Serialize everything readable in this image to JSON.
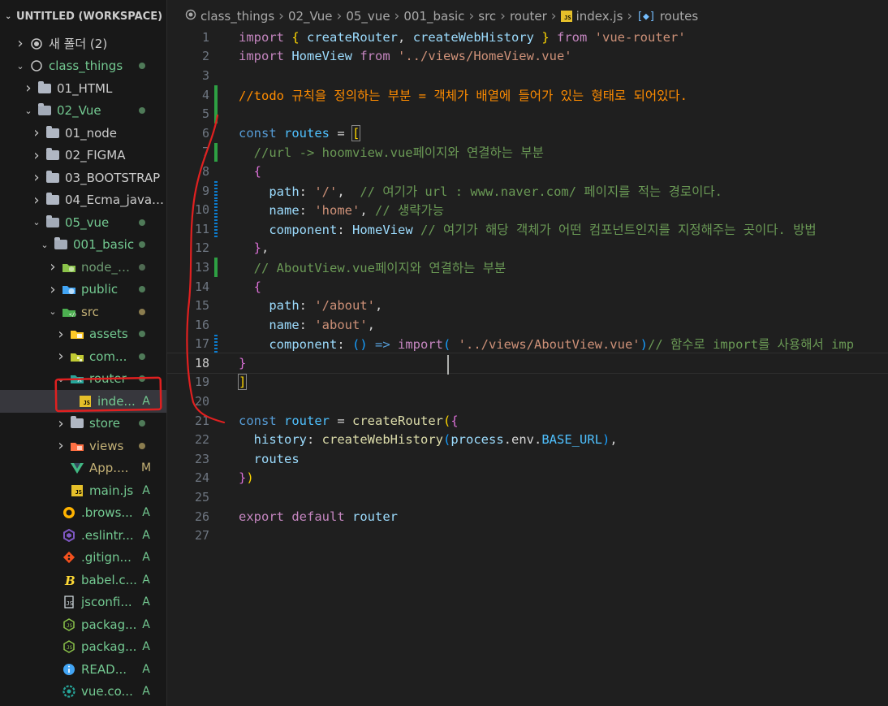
{
  "sidebar": {
    "workspace_title": "UNTITLED (WORKSPACE)",
    "items": [
      {
        "label": "새 폴더 (2)",
        "depth": 1,
        "chevron": "right",
        "icon": "circle-dot-icon",
        "status": ""
      },
      {
        "label": "class_things",
        "depth": 1,
        "chevron": "down",
        "icon": "circle-icon",
        "status": "dot-green"
      },
      {
        "label": "01_HTML",
        "depth": 2,
        "chevron": "right",
        "icon": "folder-icon",
        "status": ""
      },
      {
        "label": "02_Vue",
        "depth": 2,
        "chevron": "down",
        "icon": "folder-open-icon",
        "status": "dot-green"
      },
      {
        "label": "01_node",
        "depth": 3,
        "chevron": "right",
        "icon": "folder-icon",
        "status": ""
      },
      {
        "label": "02_FIGMA",
        "depth": 3,
        "chevron": "right",
        "icon": "folder-icon",
        "status": ""
      },
      {
        "label": "03_BOOTSTRAP",
        "depth": 3,
        "chevron": "right",
        "icon": "folder-icon",
        "status": ""
      },
      {
        "label": "04_Ecma_javas...",
        "depth": 3,
        "chevron": "right",
        "icon": "folder-icon",
        "status": ""
      },
      {
        "label": "05_vue",
        "depth": 3,
        "chevron": "down",
        "icon": "folder-open-icon",
        "status": "dot-green"
      },
      {
        "label": "001_basic",
        "depth": 4,
        "chevron": "down",
        "icon": "folder-open-icon",
        "status": "dot-green"
      },
      {
        "label": "node_modu...",
        "depth": 5,
        "chevron": "right",
        "icon": "node-folder-icon",
        "status": "dot-dim"
      },
      {
        "label": "public",
        "depth": 5,
        "chevron": "right",
        "icon": "public-folder-icon",
        "status": "dot-green"
      },
      {
        "label": "src",
        "depth": 5,
        "chevron": "down",
        "icon": "src-folder-icon",
        "status": "dot-olive"
      },
      {
        "label": "assets",
        "depth": 6,
        "chevron": "right",
        "icon": "assets-folder-icon",
        "status": "dot-green"
      },
      {
        "label": "com...",
        "depth": 6,
        "chevron": "right",
        "icon": "components-folder-icon",
        "status": "dot-green"
      },
      {
        "label": "router",
        "depth": 6,
        "chevron": "down",
        "icon": "router-folder-icon",
        "status": "dot-green"
      },
      {
        "label": "inde...",
        "depth": 7,
        "chevron": "none",
        "icon": "js-file-icon",
        "status": "A",
        "selected": true
      },
      {
        "label": "store",
        "depth": 6,
        "chevron": "right",
        "icon": "folder-icon",
        "status": "dot-green"
      },
      {
        "label": "views",
        "depth": 6,
        "chevron": "right",
        "icon": "views-folder-icon",
        "status": "dot-olive"
      },
      {
        "label": "App....",
        "depth": 6,
        "chevron": "none",
        "icon": "vue-file-icon",
        "status": "M"
      },
      {
        "label": "main.js",
        "depth": 6,
        "chevron": "none",
        "icon": "js-file-icon",
        "status": "A"
      },
      {
        "label": ".brows...",
        "depth": 5,
        "chevron": "none",
        "icon": "browserslist-icon",
        "status": "A"
      },
      {
        "label": ".eslintr...",
        "depth": 5,
        "chevron": "none",
        "icon": "eslint-icon",
        "status": "A"
      },
      {
        "label": ".gitign...",
        "depth": 5,
        "chevron": "none",
        "icon": "git-icon",
        "status": "A"
      },
      {
        "label": "babel.c...",
        "depth": 5,
        "chevron": "none",
        "icon": "babel-icon",
        "status": "A"
      },
      {
        "label": "jsconfi...",
        "depth": 5,
        "chevron": "none",
        "icon": "json-file-icon",
        "status": "A"
      },
      {
        "label": "packag...",
        "depth": 5,
        "chevron": "none",
        "icon": "npm-json-icon",
        "status": "A"
      },
      {
        "label": "packag...",
        "depth": 5,
        "chevron": "none",
        "icon": "npm-json-icon",
        "status": "A"
      },
      {
        "label": "READ...",
        "depth": 5,
        "chevron": "none",
        "icon": "info-icon",
        "status": "A"
      },
      {
        "label": "vue.co...",
        "depth": 5,
        "chevron": "none",
        "icon": "vue-config-icon",
        "status": "A"
      }
    ]
  },
  "breadcrumb": [
    "class_things",
    "02_Vue",
    "05_vue",
    "001_basic",
    "src",
    "router",
    "index.js",
    "routes"
  ],
  "editor": {
    "active_line": 18,
    "lines": [
      {
        "n": "1",
        "gutter": "",
        "tokens": [
          [
            "kw",
            "import"
          ],
          [
            "",
            "​ "
          ],
          [
            "br1",
            "{"
          ],
          [
            "",
            ""
          ],
          [
            "var",
            " createRouter"
          ],
          [
            "",
            ","
          ],
          [
            "var",
            " createWebHistory"
          ],
          [
            "",
            ""
          ],
          [
            "br1",
            " }"
          ],
          [
            "kw",
            " from"
          ],
          [
            "str",
            " 'vue-router'"
          ]
        ]
      },
      {
        "n": "2",
        "gutter": "",
        "tokens": [
          [
            "kw",
            "import"
          ],
          [
            "var",
            " HomeView"
          ],
          [
            "kw",
            " from"
          ],
          [
            "str",
            " '../views/HomeView.vue'"
          ]
        ]
      },
      {
        "n": "3",
        "gutter": "",
        "tokens": []
      },
      {
        "n": "4",
        "gutter": "add",
        "tokens": [
          [
            "todo",
            "//todo 규칙을 정의하는 부분 = 객체가 배열에 들어가 있는 형태로 되어있다."
          ]
        ]
      },
      {
        "n": "5",
        "gutter": "add",
        "tokens": []
      },
      {
        "n": "6",
        "gutter": "",
        "tokens": [
          [
            "kb",
            "const"
          ],
          [
            "const",
            " routes"
          ],
          [
            "",
            " = "
          ],
          [
            "br1 bm",
            "["
          ]
        ]
      },
      {
        "n": "7",
        "gutter": "add",
        "tokens": [
          [
            "cm",
            "  //url -> hoomview.vue페이지와 연결하는 부분"
          ]
        ]
      },
      {
        "n": "8",
        "gutter": "",
        "tokens": [
          [
            "",
            "  "
          ],
          [
            "br2",
            "{"
          ]
        ]
      },
      {
        "n": "9",
        "gutter": "mod",
        "tokens": [
          [
            "var",
            "    path"
          ],
          [
            "",
            ": "
          ],
          [
            "str",
            "'/'"
          ],
          [
            "",
            ",  "
          ],
          [
            "cm",
            "// 여기가 url : www.naver.com/ 페이지를 적는 경로이다."
          ]
        ]
      },
      {
        "n": "10",
        "gutter": "mod",
        "tokens": [
          [
            "var",
            "    name"
          ],
          [
            "",
            ": "
          ],
          [
            "str",
            "'home'"
          ],
          [
            "",
            ", "
          ],
          [
            "cm",
            "// 생략가능"
          ]
        ]
      },
      {
        "n": "11",
        "gutter": "mod",
        "tokens": [
          [
            "var",
            "    component"
          ],
          [
            "",
            ": "
          ],
          [
            "var",
            "HomeView"
          ],
          [
            "cm",
            " // 여기가 해당 객체가 어떤 컴포넌트인지를 지정해주는 곳이다. 방법"
          ]
        ]
      },
      {
        "n": "12",
        "gutter": "",
        "tokens": [
          [
            "",
            "  "
          ],
          [
            "br2",
            "}"
          ],
          [
            "",
            ","
          ]
        ]
      },
      {
        "n": "13",
        "gutter": "add",
        "tokens": [
          [
            "cm",
            "  // AboutView.vue페이지와 연결하는 부분"
          ]
        ]
      },
      {
        "n": "14",
        "gutter": "",
        "tokens": [
          [
            "",
            "  "
          ],
          [
            "br2",
            "{"
          ]
        ]
      },
      {
        "n": "15",
        "gutter": "",
        "tokens": [
          [
            "var",
            "    path"
          ],
          [
            "",
            ": "
          ],
          [
            "str",
            "'/about'"
          ],
          [
            "",
            ","
          ]
        ]
      },
      {
        "n": "16",
        "gutter": "",
        "tokens": [
          [
            "var",
            "    name"
          ],
          [
            "",
            ": "
          ],
          [
            "str",
            "'about'"
          ],
          [
            "",
            ","
          ]
        ]
      },
      {
        "n": "17",
        "gutter": "mod",
        "tokens": [
          [
            "var",
            "    component"
          ],
          [
            "",
            ": "
          ],
          [
            "br3",
            "()"
          ],
          [
            "kb",
            " =>"
          ],
          [
            "kw",
            " import"
          ],
          [
            "br3",
            "("
          ],
          [
            "str",
            " '../views/AboutView.vue'"
          ],
          [
            "br3",
            ")"
          ],
          [
            "cm",
            "// 함수로 import를 사용해서 imp"
          ]
        ]
      },
      {
        "n": "18",
        "gutter": "",
        "tokens": [
          [
            "br2",
            "}"
          ]
        ]
      },
      {
        "n": "19",
        "gutter": "",
        "tokens": [
          [
            "br1 bm",
            "]"
          ]
        ]
      },
      {
        "n": "20",
        "gutter": "",
        "tokens": []
      },
      {
        "n": "21",
        "gutter": "",
        "tokens": [
          [
            "kb",
            "const"
          ],
          [
            "const",
            " router"
          ],
          [
            "",
            " = "
          ],
          [
            "fn",
            "createRouter"
          ],
          [
            "br1",
            "("
          ],
          [
            "br2",
            "{"
          ]
        ]
      },
      {
        "n": "22",
        "gutter": "",
        "tokens": [
          [
            "var",
            "  history"
          ],
          [
            "",
            ": "
          ],
          [
            "fn",
            "createWebHistory"
          ],
          [
            "br3",
            "("
          ],
          [
            "var",
            "process"
          ],
          [
            "",
            ".env."
          ],
          [
            "const",
            "BASE_URL"
          ],
          [
            "br3",
            ")"
          ],
          [
            "",
            ","
          ]
        ]
      },
      {
        "n": "23",
        "gutter": "",
        "tokens": [
          [
            "var",
            "  routes"
          ]
        ]
      },
      {
        "n": "24",
        "gutter": "",
        "tokens": [
          [
            "br2",
            "}"
          ],
          [
            "br1",
            ")"
          ]
        ]
      },
      {
        "n": "25",
        "gutter": "",
        "tokens": []
      },
      {
        "n": "26",
        "gutter": "",
        "tokens": [
          [
            "kw",
            "export"
          ],
          [
            "kw",
            " default"
          ],
          [
            "var",
            " router"
          ]
        ]
      },
      {
        "n": "27",
        "gutter": "",
        "tokens": []
      }
    ]
  },
  "colors": {
    "annotation": "#e02020",
    "git_added": "#73c991",
    "git_modified": "#c4b176"
  }
}
